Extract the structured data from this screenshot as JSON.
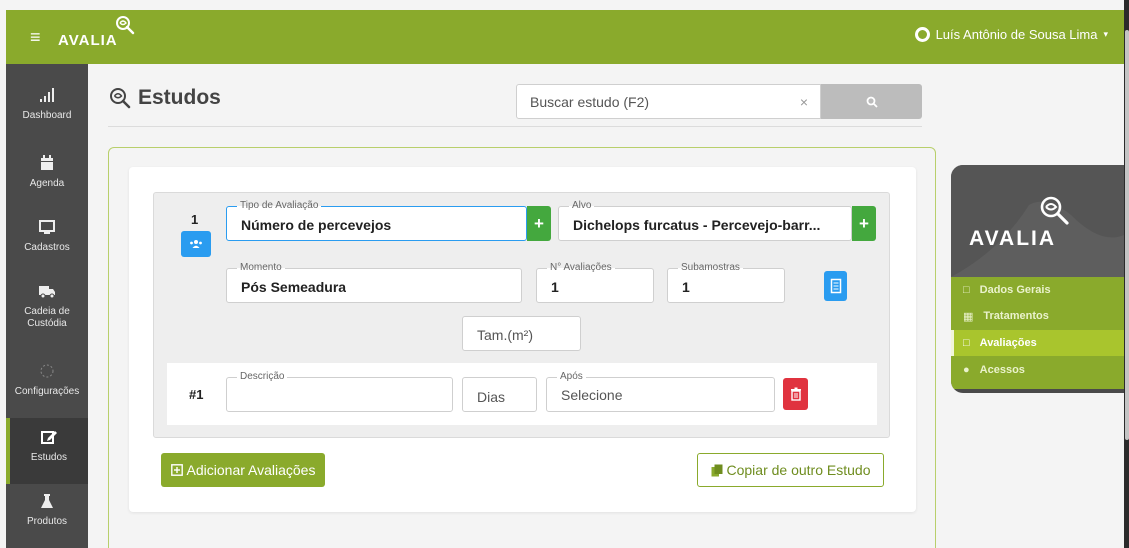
{
  "app": {
    "brand": "AVALIA",
    "user_name": "Luís Antônio de Sousa Lima",
    "accent_color": "#8aaa2c"
  },
  "sidebar": {
    "items": [
      {
        "label": "Dashboard",
        "icon": "bar-chart-icon"
      },
      {
        "label": "Agenda",
        "icon": "calendar-icon"
      },
      {
        "label": "Cadastros",
        "icon": "monitor-icon"
      },
      {
        "label": "Cadeia de Custódia",
        "icon": "truck-icon"
      },
      {
        "label": "Configurações",
        "icon": "gear-icon"
      },
      {
        "label": "Estudos",
        "icon": "edit-icon"
      },
      {
        "label": "Produtos",
        "icon": "flask-icon"
      }
    ]
  },
  "page": {
    "title": "Estudos",
    "search_placeholder": "Buscar estudo (F2)",
    "search_clear": "×"
  },
  "evaluation": {
    "number": "1",
    "tipo_label": "Tipo de Avaliação",
    "tipo_value": "Número de percevejos",
    "alvo_label": "Alvo",
    "alvo_value": "Dichelops furcatus  - Percevejo-barr...",
    "momento_label": "Momento",
    "momento_value": "Pós Semeadura",
    "n_avaliacoes_label": "N° Avaliações",
    "n_avaliacoes_value": "1",
    "subamostras_label": "Subamostras",
    "subamostras_value": "1",
    "tam_placeholder": "Tam.(m²)",
    "plus": "+"
  },
  "detail_row": {
    "index": "#1",
    "descricao_label": "Descrição",
    "dias_placeholder": "Dias",
    "apos_label": "Após",
    "apos_value": "Selecione"
  },
  "buttons": {
    "add": "Adicionar Avaliações",
    "copy": "Copiar de outro Estudo"
  },
  "right_panel": {
    "brand": "AVALIA",
    "items": [
      {
        "label": "Dados Gerais",
        "active": false
      },
      {
        "label": "Tratamentos",
        "active": false
      },
      {
        "label": "Avaliações",
        "active": true
      },
      {
        "label": "Acessos",
        "active": false
      }
    ]
  }
}
